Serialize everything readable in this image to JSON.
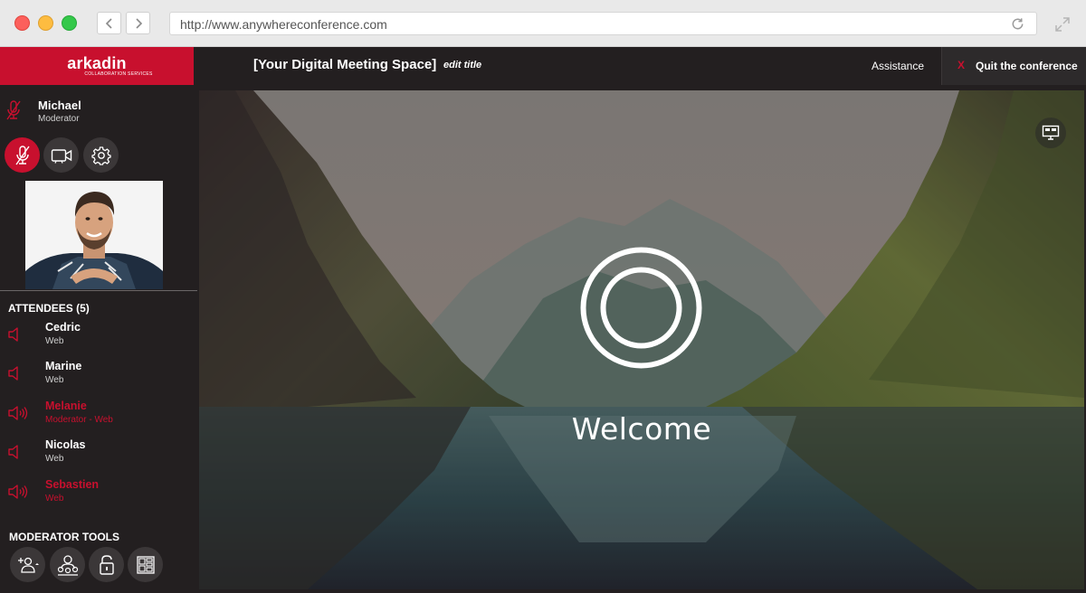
{
  "browser": {
    "url": "http://www.anywhereconference.com",
    "icons": [
      "back-icon",
      "forward-icon",
      "reload-icon",
      "fullscreen-icon"
    ]
  },
  "app": {
    "logo": "arkadin",
    "logo_sub": "COLLABORATION SERVICES",
    "meeting_title": "[Your Digital Meeting Space]",
    "edit_title": "edit title",
    "assistance": "Assistance",
    "quit_x": "X",
    "quit_label": "Quit the conference"
  },
  "colors": {
    "brand": "#c8102e",
    "background": "#231f20"
  },
  "user": {
    "name": "Michael",
    "role": "Moderator",
    "controls": [
      "mic-muted-icon",
      "camera-icon",
      "gear-icon"
    ]
  },
  "attendees": {
    "title": "ATTENDEES (5)",
    "items": [
      {
        "name": "Cedric",
        "sub": "Web",
        "speaking": false
      },
      {
        "name": "Marine",
        "sub": "Web",
        "speaking": false
      },
      {
        "name": "Melanie",
        "sub": "Moderator - Web",
        "speaking": true
      },
      {
        "name": "Nicolas",
        "sub": "Web",
        "speaking": false
      },
      {
        "name": "Sebastien",
        "sub": "Web",
        "speaking": true
      }
    ]
  },
  "moderator_tools": {
    "title": "MODERATOR TOOLS",
    "tools": [
      "add-participant-icon",
      "participants-icon",
      "lock-icon",
      "layout-grid-icon"
    ]
  },
  "stage": {
    "welcome": "Welcome",
    "icons": [
      "screen-share-icon",
      "welcome-rings-icon"
    ]
  }
}
